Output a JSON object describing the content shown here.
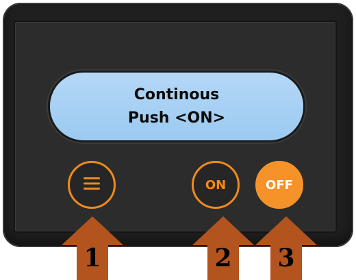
{
  "display": {
    "line1": "Continous",
    "line2": "Push <ON>"
  },
  "buttons": [
    {
      "id": "menu",
      "icon": "hamburger-menu-icon",
      "label": ""
    },
    {
      "id": "on",
      "label": "ON"
    },
    {
      "id": "off",
      "label": "OFF"
    }
  ],
  "callouts": [
    {
      "number": "1",
      "target": "menu"
    },
    {
      "number": "2",
      "target": "on"
    },
    {
      "number": "3",
      "target": "off"
    }
  ],
  "colors": {
    "frame": "#1f1f1f",
    "screen": "#a8d0f3",
    "button_orange": "#f08a1c",
    "button_off_fill": "#f5922a",
    "arrow": "#b3541e"
  }
}
